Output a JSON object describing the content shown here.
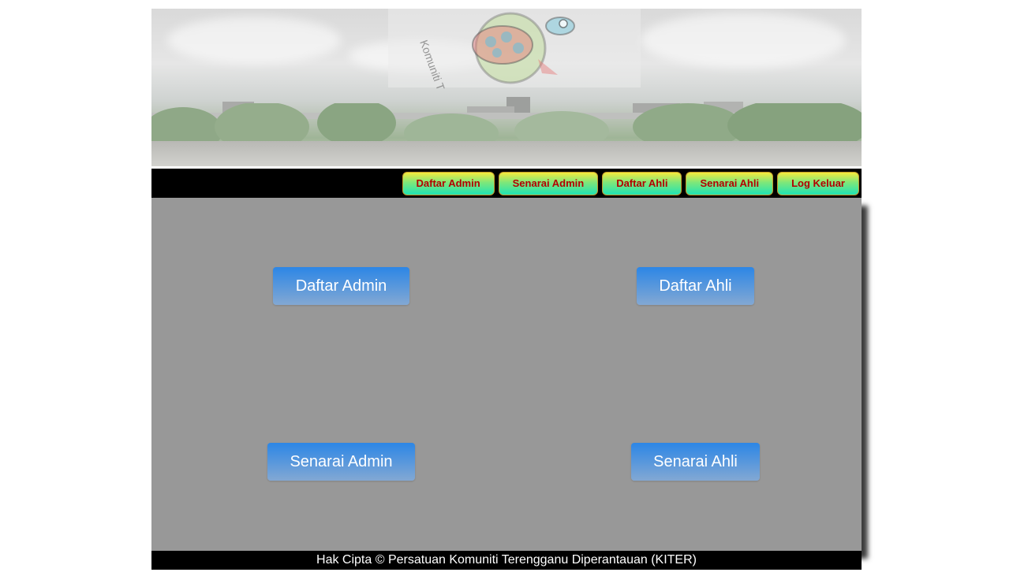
{
  "banner": {
    "logo_text": "Komuniti Terengganu DiPerantauan",
    "logo_icon": "turtle-logo"
  },
  "nav": {
    "items": [
      {
        "label": "Daftar Admin"
      },
      {
        "label": "Senarai Admin"
      },
      {
        "label": "Daftar Ahli"
      },
      {
        "label": "Senarai Ahli"
      },
      {
        "label": "Log Keluar"
      }
    ]
  },
  "main": {
    "buttons": {
      "daftar_admin": "Daftar Admin",
      "daftar_ahli": "Daftar Ahli",
      "senarai_admin": "Senarai Admin",
      "senarai_ahli": "Senarai Ahli"
    }
  },
  "footer": {
    "text": "Hak Cipta © Persatuan Komuniti Terengganu Diperantauan (KITER)"
  },
  "colors": {
    "nav_bg": "#000000",
    "content_bg": "#989898",
    "button_blue": "#2c86e6",
    "nav_text": "#b30000"
  }
}
